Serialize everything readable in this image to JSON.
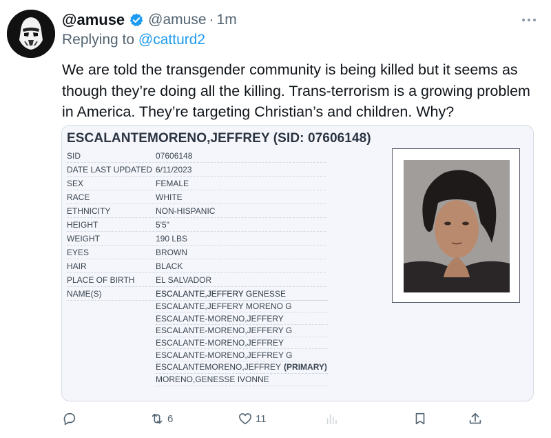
{
  "author": {
    "display_name": "@amuse",
    "handle": "@amuse",
    "separator": "·",
    "time": "1m",
    "verified_icon": "verified-badge-icon",
    "avatar_icon": "stormtrooper-avatar"
  },
  "reply": {
    "prefix": "Replying to",
    "mention": "@catturd2"
  },
  "tweet": {
    "text": "We are told the transgender community is being killed but it seems as though they’re doing all the killing. Trans-terrorism is a growing problem in America. They’re targeting Christian’s and children. Why?"
  },
  "record": {
    "title": "ESCALANTEMORENO,JEFFREY (SID: 07606148)",
    "fields": [
      {
        "label": "SID",
        "value": "07606148"
      },
      {
        "label": "DATE LAST UPDATED",
        "value": "6/11/2023"
      },
      {
        "label": "SEX",
        "value": "FEMALE"
      },
      {
        "label": "RACE",
        "value": "WHITE"
      },
      {
        "label": "ETHNICITY",
        "value": "NON-HISPANIC"
      },
      {
        "label": "HEIGHT",
        "value": "5'5\""
      },
      {
        "label": "WEIGHT",
        "value": "190 LBS"
      },
      {
        "label": "EYES",
        "value": "BROWN"
      },
      {
        "label": "HAIR",
        "value": "BLACK"
      },
      {
        "label": "PLACE OF BIRTH",
        "value": "EL SALVADOR"
      },
      {
        "label": "NAME(S)",
        "value": "ESCALANTE,JEFFERY G"
      }
    ],
    "additional_names": [
      {
        "name": "ESCALANTE,JEFFERY GENESSE",
        "tag": ""
      },
      {
        "name": "ESCALANTE,JEFFERY MORENO G",
        "tag": ""
      },
      {
        "name": "ESCALANTE-MORENO,JEFFERY",
        "tag": ""
      },
      {
        "name": "ESCALANTE-MORENO,JEFFERY G",
        "tag": ""
      },
      {
        "name": "ESCALANTE-MORENO,JEFFREY",
        "tag": ""
      },
      {
        "name": "ESCALANTE-MORENO,JEFFREY G",
        "tag": ""
      },
      {
        "name": "ESCALANTEMORENO,JEFFREY",
        "tag": "(PRIMARY)"
      },
      {
        "name": "MORENO,GENESSE IVONNE",
        "tag": ""
      }
    ]
  },
  "actions": {
    "reply_icon": "reply-icon",
    "retweet_icon": "retweet-icon",
    "retweet_count": "6",
    "like_icon": "heart-icon",
    "like_count": "11",
    "views_icon": "views-icon",
    "bookmark_icon": "bookmark-icon",
    "share_icon": "share-icon"
  },
  "colors": {
    "accent": "#1d9bf0",
    "text": "#0f1419",
    "muted": "#536471",
    "card_bg": "#f4f6fb"
  }
}
